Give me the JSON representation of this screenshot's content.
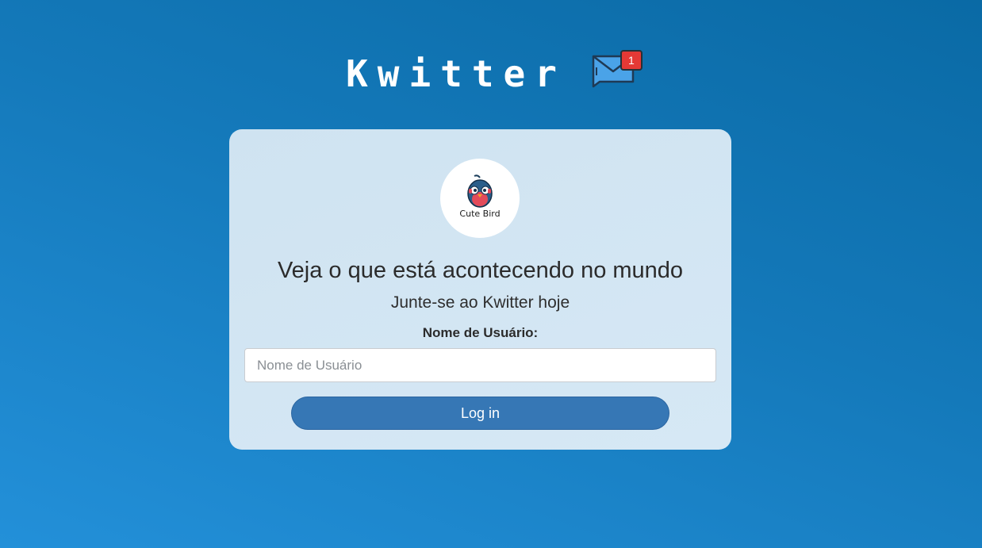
{
  "header": {
    "title": "Kwitter",
    "mail_badge_count": "1",
    "mail_icon": "envelope-icon"
  },
  "card": {
    "logo_text": "Cute Bird",
    "logo_icon": "bird-logo-icon",
    "headline": "Veja o que está acontecendo no mundo",
    "subline": "Junte-se ao Kwitter hoje",
    "username_label": "Nome de Usuário:",
    "username_placeholder": "Nome de Usuário",
    "username_value": "",
    "login_label": "Log in"
  },
  "colors": {
    "background_top": "#0a6aa5",
    "background_bottom": "#2390d9",
    "card_bg": "#d2e5f3",
    "button_bg": "#3677b5",
    "badge_bg": "#e53935",
    "envelope_fill": "#4aa3e8"
  }
}
